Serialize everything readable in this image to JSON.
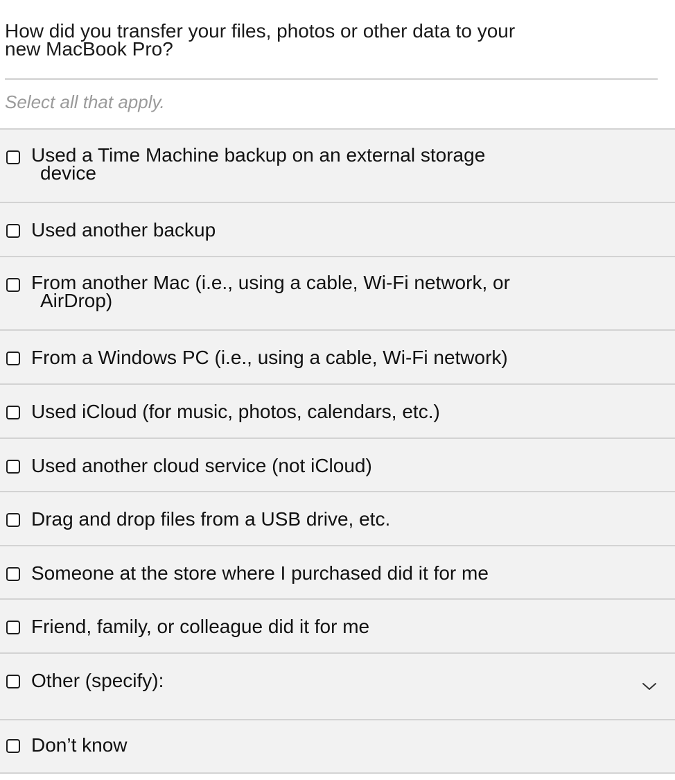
{
  "question": {
    "line1": "How did you transfer your files, photos or other data to your",
    "line2": "new MacBook Pro?"
  },
  "instruction": "Select all that apply.",
  "options": [
    {
      "line1": "Used a Time Machine backup on an external storage",
      "line2": "device",
      "checked": false
    },
    {
      "label": "Used another backup",
      "checked": false
    },
    {
      "line1": "From another Mac (i.e., using a cable, Wi-Fi network, or",
      "line2": "AirDrop)",
      "checked": false
    },
    {
      "label": "From a Windows PC (i.e., using a cable, Wi-Fi network)",
      "checked": false
    },
    {
      "label": "Used iCloud (for music, photos, calendars, etc.)",
      "checked": false
    },
    {
      "label": "Used another cloud service (not iCloud)",
      "checked": false
    },
    {
      "label": "Drag and drop files from a USB drive, etc.",
      "checked": false
    },
    {
      "label": "Someone at the store where I purchased did it for me",
      "checked": false
    },
    {
      "label": "Friend, family, or colleague did it for me",
      "checked": false
    },
    {
      "label": "Other (specify):",
      "checked": false,
      "expand_icon": "chevron-down-icon"
    },
    {
      "label": "Don’t know",
      "checked": false
    }
  ]
}
